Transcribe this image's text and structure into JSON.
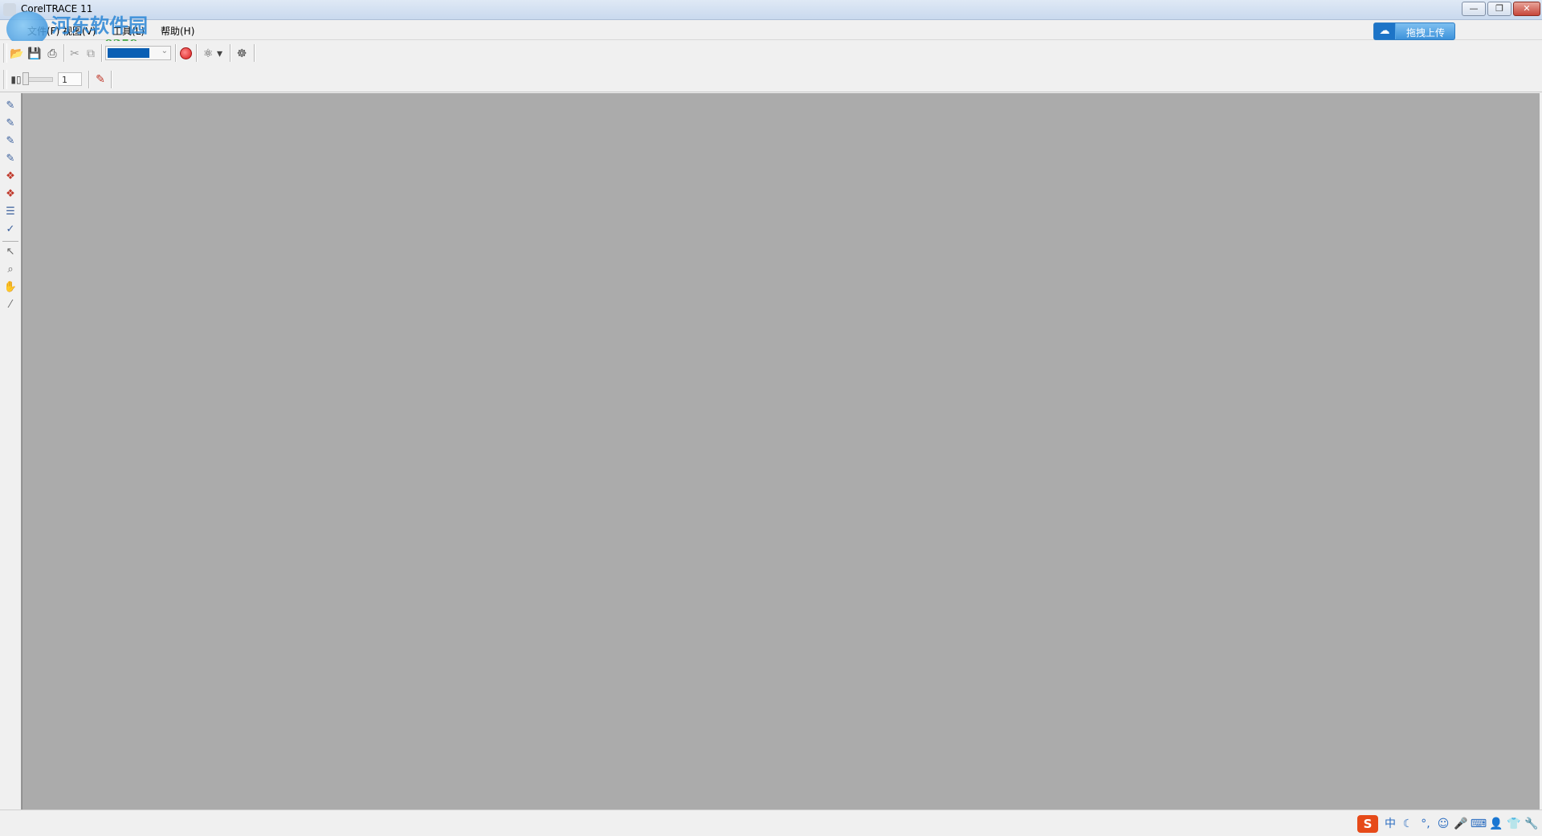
{
  "window": {
    "title": "CorelTRACE 11"
  },
  "title_buttons": {
    "minimize": "—",
    "restore": "❐",
    "close": "✕"
  },
  "menu": {
    "items": [
      {
        "label": "文件(F)"
      },
      {
        "label": "视图(V)"
      },
      {
        "label": "工具(L)"
      },
      {
        "label": "帮助(H)"
      }
    ]
  },
  "upload_button": {
    "label": "拖拽上传",
    "icon": "cloud-icon"
  },
  "watermark": {
    "name": "河东软件园",
    "url": "www.pc0359.cn"
  },
  "toolbar": {
    "color_value": "#0a5fb4",
    "scan_label": "⚛"
  },
  "toolbar2": {
    "spin_value": "1"
  },
  "toolbox": {
    "icons": [
      "trace-outline-icon",
      "trace-centerline-icon",
      "trace-woodcut-icon",
      "trace-sketch-icon",
      "trace-mosaic-icon",
      "trace-3d-mosaic-icon",
      "trace-form-icon",
      "trace-ocr-icon",
      "pick-tool-icon",
      "zoom-tool-icon",
      "hand-tool-icon",
      "eyedropper-tool-icon"
    ]
  },
  "statusbar": {
    "ime_items": [
      "中",
      "☾",
      "°,",
      "☺",
      "🎤",
      "⌨",
      "👤",
      "👕",
      "🔧"
    ],
    "ime_logo": "S"
  },
  "colors": {
    "workspace": "#ababab",
    "chrome": "#f0f0f0",
    "accent": "#3e93db"
  }
}
